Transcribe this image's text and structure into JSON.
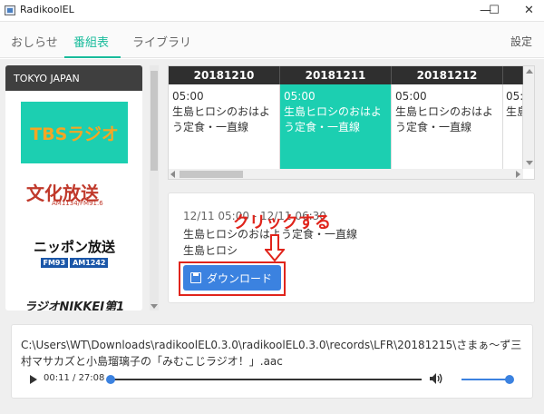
{
  "window": {
    "title": "RadikoolEL",
    "minimize_glyph": "—",
    "maximize_glyph": "☐",
    "close_glyph": "✕"
  },
  "tabs": [
    {
      "label": "おしらせ",
      "active": false
    },
    {
      "label": "番組表",
      "active": true
    },
    {
      "label": "ライブラリ",
      "active": false
    }
  ],
  "settings_label": "設定",
  "accent_color": "#1abc9c",
  "stations_panel": {
    "area": "TOKYO JAPAN",
    "stations": [
      {
        "name": "TBSラジオ"
      },
      {
        "name": "文化放送",
        "sub": "AM1134/FM91.6"
      },
      {
        "name": "ニッポン放送",
        "freq1": "FM93",
        "freq2": "AM1242"
      },
      {
        "name": "ラジオNIKKEI第1"
      }
    ]
  },
  "grid": {
    "columns": [
      {
        "date": "20181210",
        "time": "05:00",
        "title": "生島ヒロシのおはよう定食・一直線",
        "selected": false
      },
      {
        "date": "20181211",
        "time": "05:00",
        "title": "生島ヒロシのおはよう定食・一直線",
        "selected": true
      },
      {
        "date": "20181212",
        "time": "05:00",
        "title": "生島ヒロシのおはよう定食・一直線",
        "selected": false
      },
      {
        "date": "",
        "time": "05:",
        "title": "生島",
        "selected": false
      }
    ]
  },
  "detail": {
    "time_range": "12/11 05:00 - 12/11 06:30",
    "title": "生島ヒロシのおはよう定食・一直線",
    "personality": "生島ヒロシ",
    "download_label": "ダウンロード"
  },
  "annotation": {
    "text": "クリックする",
    "color": "#e0241b"
  },
  "player": {
    "file_path": "C:\\Users\\WT\\Downloads\\radikoolEL0.3.0\\radikoolEL0.3.0\\records\\LFR\\20181215\\さまぁ～ず三村マサカズと小島瑠璃子の「みむこじラジオ！」.aac",
    "elapsed": "00:11",
    "duration": "27:08",
    "progress_fraction": 0.007,
    "volume_fraction": 1.0
  }
}
